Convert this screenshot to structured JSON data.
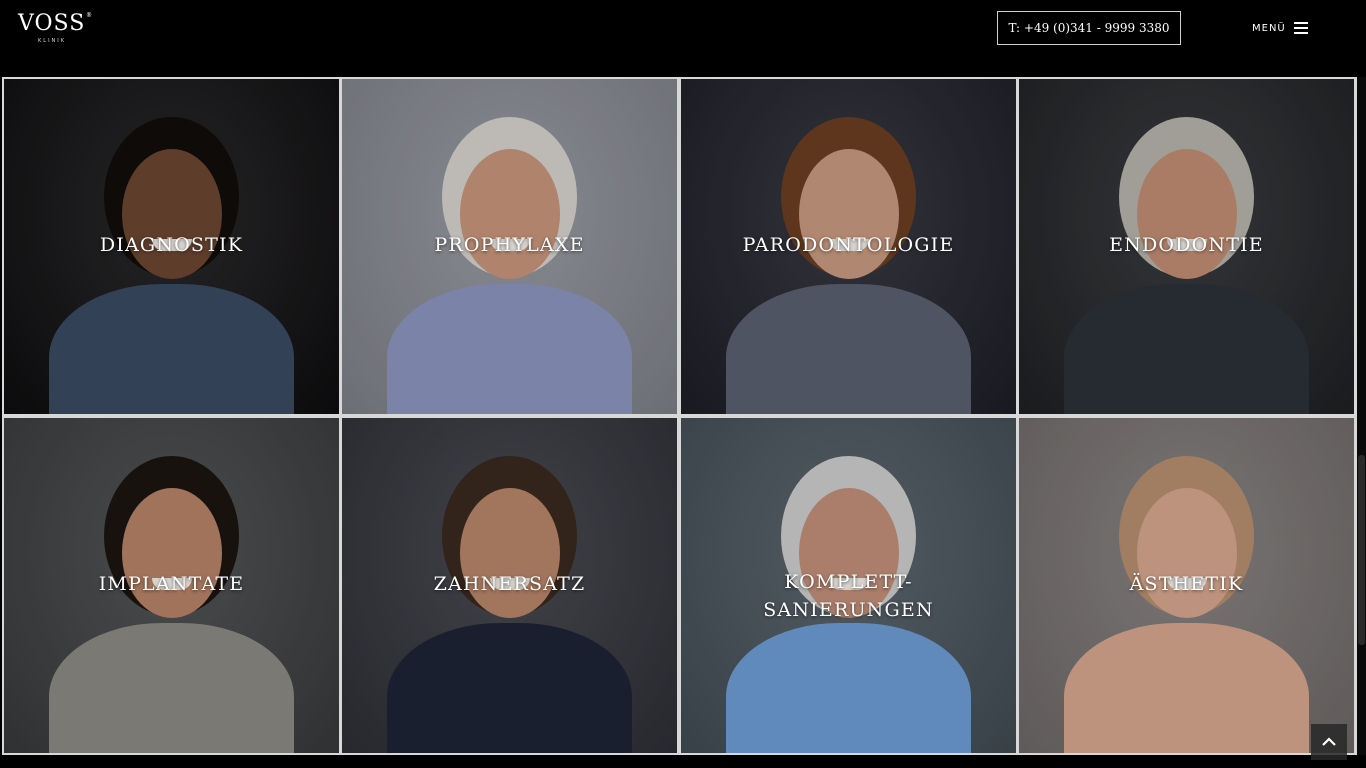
{
  "header": {
    "logo_main": "VOSS",
    "logo_sub": "KLINIK",
    "logo_reg": "®",
    "phone": "T: +49 (0)341 - 9999 3380",
    "menu_label": "MENÜ"
  },
  "tiles": [
    {
      "label": "DIAGNOSTIK",
      "bg": "#2b2a2c",
      "skin": "#6b4630",
      "hair": "#120d0a",
      "cloth": "#3a4a62"
    },
    {
      "label": "PROPHYLAXE",
      "bg": "#9a9ca4",
      "skin": "#c8967c",
      "hair": "#d8d4d0",
      "cloth": "#8c96c0"
    },
    {
      "label": "PARODONTOLOGIE",
      "bg": "#3a3a44",
      "skin": "#c99a80",
      "hair": "#6a3e22",
      "cloth": "#5a6070"
    },
    {
      "label": "ENDODONTIE",
      "bg": "#3b3d40",
      "skin": "#c28e74",
      "hair": "#b8b4ae",
      "cloth": "#2c3038"
    },
    {
      "label": "IMPLANTATE",
      "bg": "#545658",
      "skin": "#b88368",
      "hair": "#1c1512",
      "cloth": "#8c8a84"
    },
    {
      "label": "ZAHNERSATZ",
      "bg": "#4a4c52",
      "skin": "#b9866a",
      "hair": "#3a2a1e",
      "cloth": "#1e2436"
    },
    {
      "label": "KOMPLETT-\nSANIERUNGEN",
      "bg": "#5e6870",
      "skin": "#c2907a",
      "hair": "#cfcfcf",
      "cloth": "#6f9ed6"
    },
    {
      "label": "ÄSTHETIK",
      "bg": "#8a8584",
      "skin": "#d8a890",
      "hair": "#b89070",
      "cloth": "#d8a890"
    }
  ],
  "icons": {
    "hamburger": "menu-icon",
    "to_top": "chevron-up-icon"
  }
}
